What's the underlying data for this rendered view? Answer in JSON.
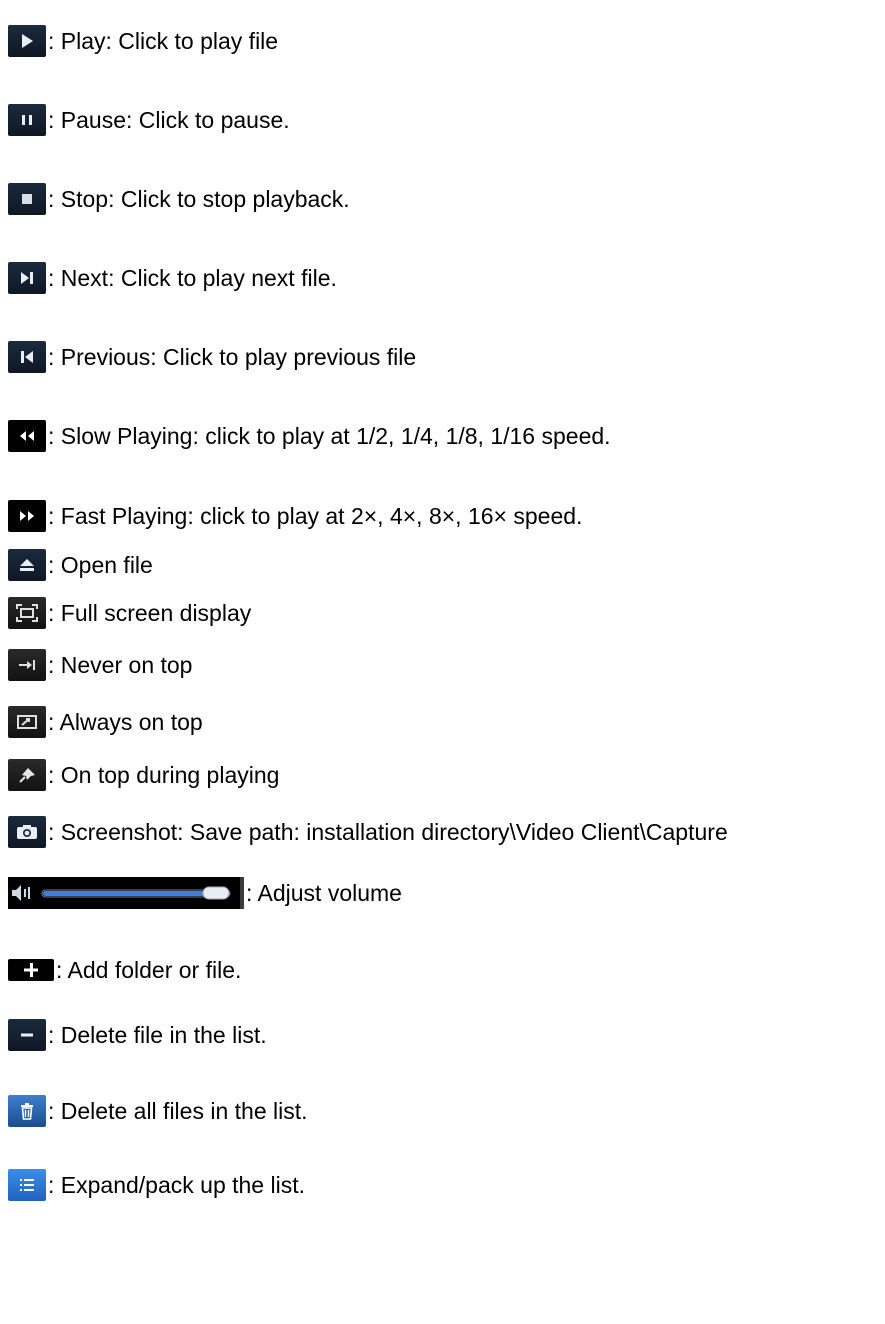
{
  "items": [
    {
      "icon": "play-icon",
      "text": ": Play: Click to play file"
    },
    {
      "icon": "pause-icon",
      "text": ": Pause: Click to pause."
    },
    {
      "icon": "stop-icon",
      "text": ": Stop: Click to stop playback."
    },
    {
      "icon": "next-icon",
      "text": ": Next: Click to play next file."
    },
    {
      "icon": "previous-icon",
      "text": ": Previous: Click to play previous file"
    },
    {
      "icon": "slow-play-icon",
      "text": ": Slow Playing: click to play at 1/2, 1/4, 1/8, 1/16 speed."
    },
    {
      "icon": "fast-play-icon",
      "text": ": Fast Playing: click to play at 2×, 4×, 8×, 16× speed."
    },
    {
      "icon": "open-file-icon",
      "text": ": Open file"
    },
    {
      "icon": "fullscreen-icon",
      "text": ": Full screen display"
    },
    {
      "icon": "never-on-top-icon",
      "text": ": Never on top"
    },
    {
      "icon": "always-on-top-icon",
      "text": ": Always on top"
    },
    {
      "icon": "on-top-during-playing-icon",
      "text": ": On top during playing"
    },
    {
      "icon": "camera-icon",
      "text": ": Screenshot: Save path: installation directory\\Video Client\\Capture"
    },
    {
      "icon": "volume-slider-icon",
      "text": ": Adjust volume",
      "volume_level": 0.95
    },
    {
      "icon": "add-icon",
      "text": ": Add folder or file."
    },
    {
      "icon": "delete-icon",
      "text": ": Delete file in the list."
    },
    {
      "icon": "trash-icon",
      "text": ": Delete all files in the list."
    },
    {
      "icon": "list-icon",
      "text": ": Expand/pack up the list."
    }
  ]
}
